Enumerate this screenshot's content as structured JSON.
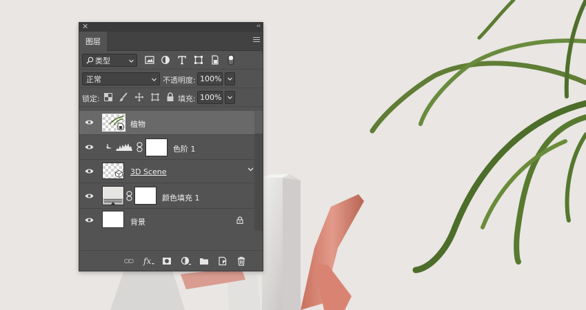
{
  "panel": {
    "tab_label": "图层",
    "filter": {
      "selected": "类型"
    },
    "blend_mode": {
      "selected": "正常"
    },
    "opacity": {
      "label": "不透明度:",
      "value": "100%"
    },
    "lock": {
      "label": "锁定:"
    },
    "fill": {
      "label": "填充:",
      "value": "100%"
    }
  },
  "layers": [
    {
      "name": "植物",
      "selected": true,
      "thumb": "smart-object"
    },
    {
      "name": "色阶 1",
      "selected": false,
      "thumb": "adjustment-levels"
    },
    {
      "name": "3D Scene",
      "selected": false,
      "thumb": "3d"
    },
    {
      "name": "颜色填充 1",
      "selected": false,
      "thumb": "solid-color"
    },
    {
      "name": "背景",
      "selected": false,
      "thumb": "background",
      "locked": true
    }
  ],
  "colors": {
    "panel_bg": "#535353",
    "selected_layer": "#696969",
    "background": "#e9e6e3"
  }
}
